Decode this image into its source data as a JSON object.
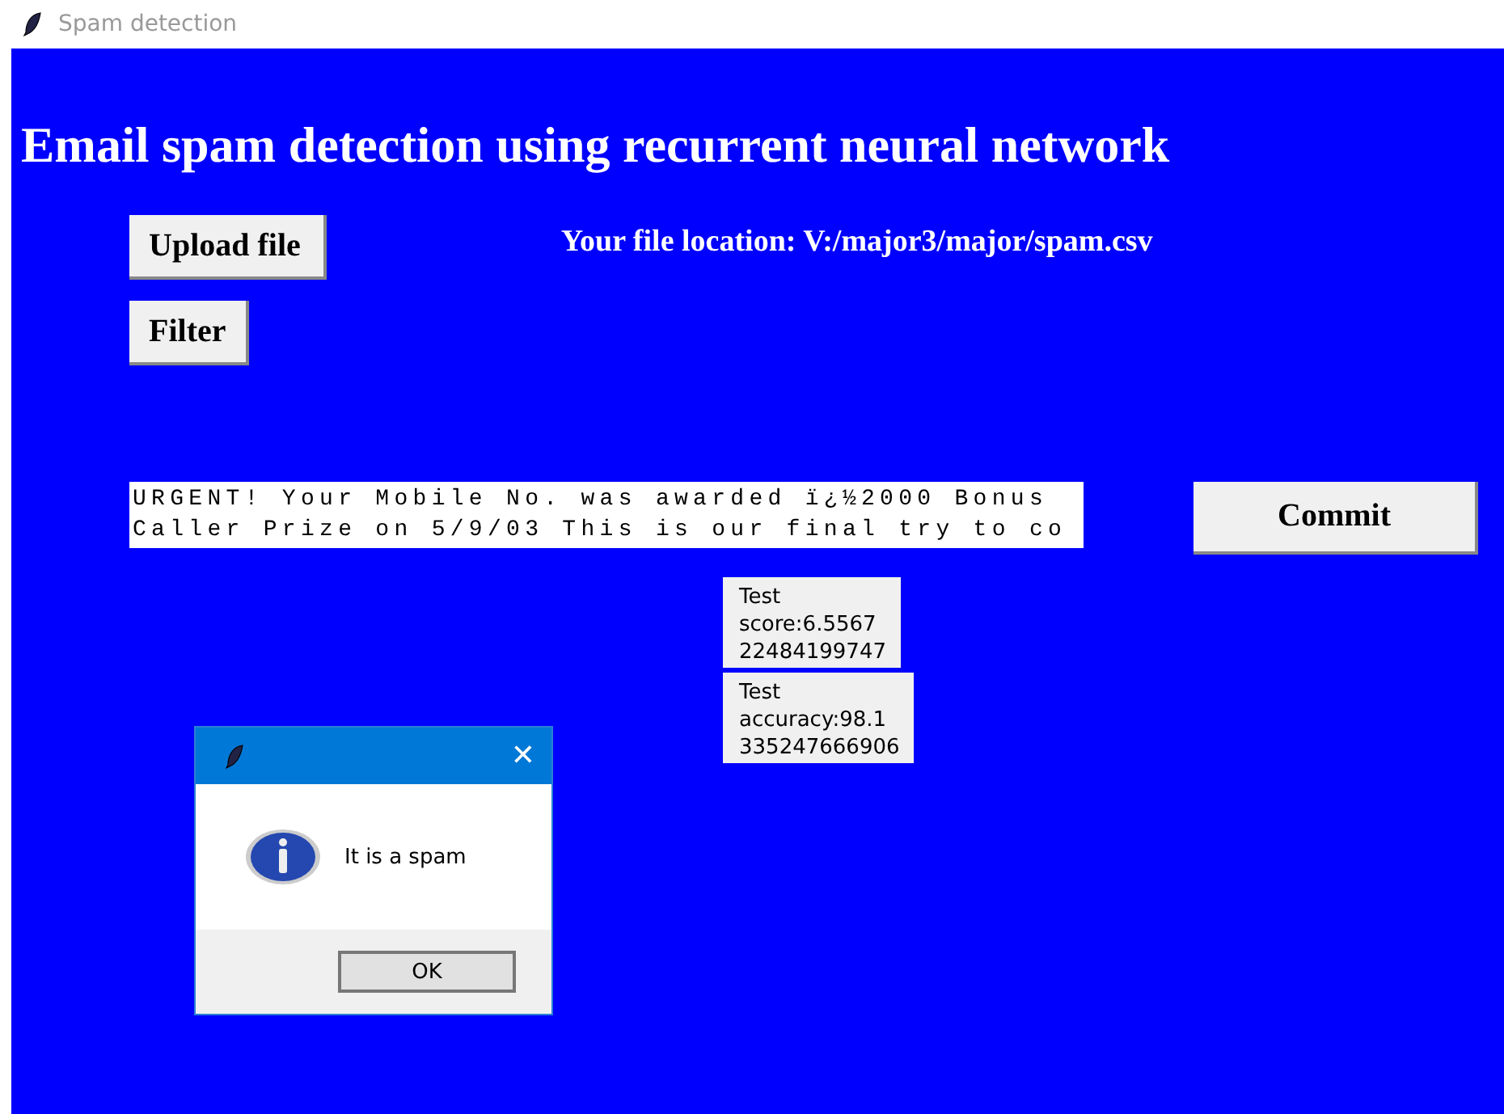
{
  "window": {
    "title": "Spam detection"
  },
  "heading": "Email spam detection using recurrent neural network",
  "upload_button": "Upload file",
  "file_location": "Your file location: V:/major3/major/spam.csv",
  "filter_button": "Filter",
  "message_box": {
    "lines": [
      "URGENT! Your Mobile No. was awarded ï¿½2000 Bonus",
      "Caller Prize on 5/9/03 This is our final try to co"
    ]
  },
  "commit_button": "Commit",
  "results": [
    {
      "lines": [
        "Test",
        "score:6.5567",
        "22484199747"
      ]
    },
    {
      "lines": [
        "Test",
        "accuracy:98.1",
        "335247666906"
      ]
    }
  ],
  "dialog": {
    "close": "✕",
    "message": "It is a spam",
    "ok_button": "OK"
  }
}
